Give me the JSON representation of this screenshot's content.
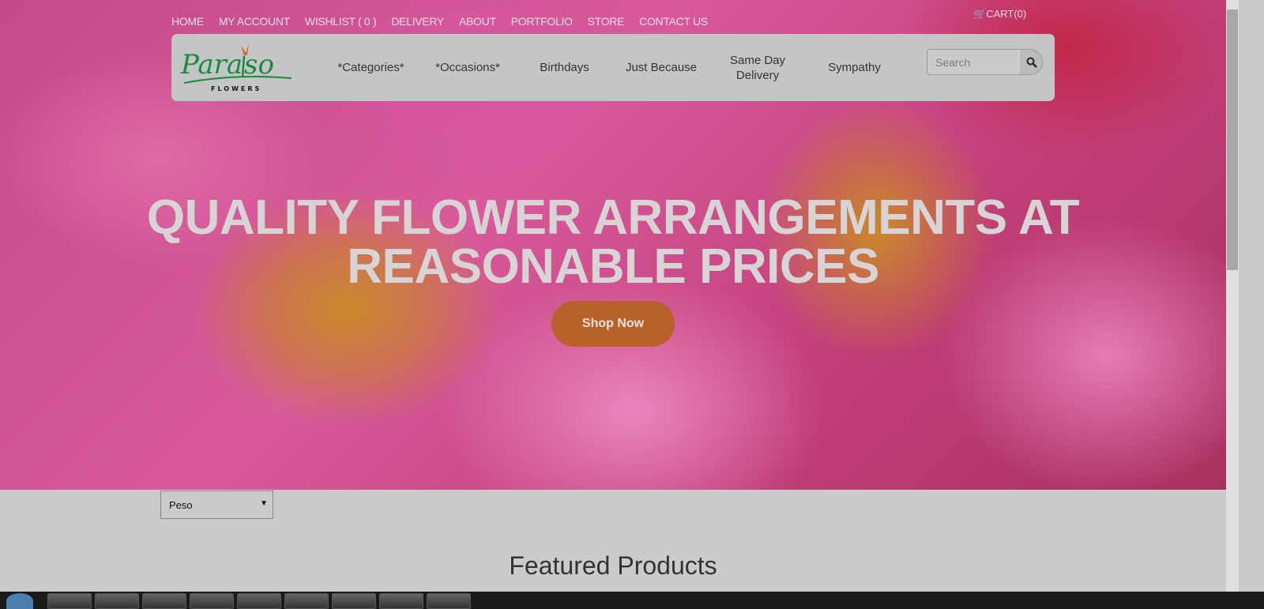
{
  "top_nav": [
    "HOME",
    "MY ACCOUNT",
    "WISHLIST ( 0 )",
    "DELIVERY",
    "ABOUT",
    "PORTFOLIO",
    "STORE",
    "CONTACT US"
  ],
  "cart": "CART(0)",
  "logo": {
    "name": "Paraiso",
    "sub": "FLOWERS"
  },
  "menu": [
    "*Categories*",
    "*Occasions*",
    "Birthdays",
    "Just Because",
    "Same Day Delivery",
    "Sympathy"
  ],
  "search": {
    "placeholder": "Search"
  },
  "hero": {
    "headline_line1": "QUALITY FLOWER ARRANGEMENTS AT",
    "headline_line2": "REASONABLE PRICES",
    "cta": "Shop Now"
  },
  "currency": {
    "selected": "Peso"
  },
  "featured_title": "Featured Products",
  "colors": {
    "cta": "#b8612a",
    "navbar": "#c3c5c7",
    "logo_green": "#1a8a3c"
  }
}
